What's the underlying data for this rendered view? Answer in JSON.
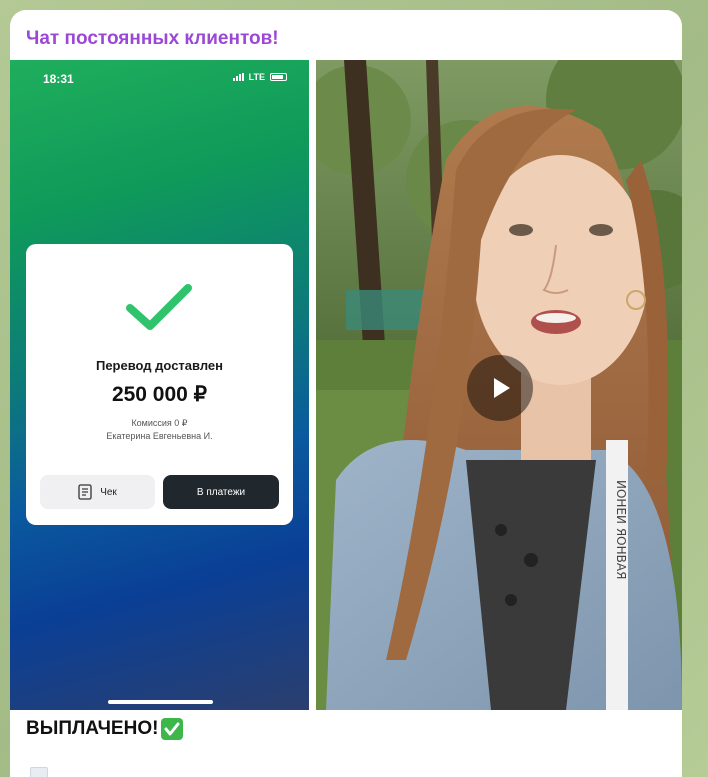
{
  "message": {
    "sender_name": "Чат постоянных клиентов!",
    "caption": "ВЫПЛАЧЕНО!",
    "caption_emoji": "check-mark-button-emoji"
  },
  "screenshot": {
    "status_time": "18:31",
    "network": "LTE",
    "transfer_title": "Перевод доставлен",
    "amount": "250 000 ₽",
    "commission": "Комиссия 0 ₽",
    "recipient": "Екатерина Евгеньевна И.",
    "receipt_button": "Чек",
    "payments_button": "В платежи"
  },
  "video": {
    "lanyard_text": "ИОНЕИ ЯОНВАЯ"
  },
  "colors": {
    "sender": "#9b48d6",
    "check_green": "#2fc46b",
    "chat_background": "#a8c08a"
  }
}
